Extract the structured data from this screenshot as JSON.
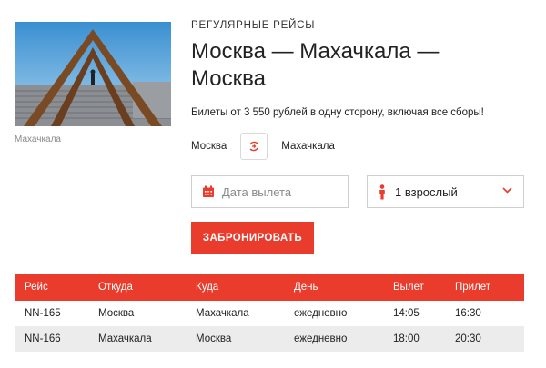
{
  "photo": {
    "caption": "Махачкала",
    "colors": {
      "sky_top": "#3a8fd1",
      "sky_bottom": "#a9d3ef",
      "frame": "#7a4a24",
      "stairs": "#8b8f93"
    }
  },
  "header": {
    "kicker": "РЕГУЛЯРНЫЕ РЕЙСЫ",
    "title_line1": "Москва — Махачкала —",
    "title_line2": "Москва",
    "price_note": "Билеты от 3 550 рублей в одну сторону, включая все сборы!"
  },
  "route": {
    "from": "Москва",
    "to": "Махачкала",
    "swap_icon": "swap-arrows-icon"
  },
  "form": {
    "date_placeholder": "Дата вылета",
    "date_value": "",
    "passengers_label": "1 взрослый",
    "book_label": "ЗАБРОНИРОВАТЬ"
  },
  "schedule": {
    "headers": [
      "Рейс",
      "Откуда",
      "Куда",
      "День",
      "Вылет",
      "Прилет"
    ],
    "rows": [
      [
        "NN-165",
        "Москва",
        "Махачкала",
        "ежедневно",
        "14:05",
        "16:30"
      ],
      [
        "NN-166",
        "Махачкала",
        "Москва",
        "ежедневно",
        "18:00",
        "20:30"
      ]
    ]
  },
  "colors": {
    "accent": "#ea3c2c",
    "row_alt": "#ececec",
    "border": "#cfcfcf"
  }
}
